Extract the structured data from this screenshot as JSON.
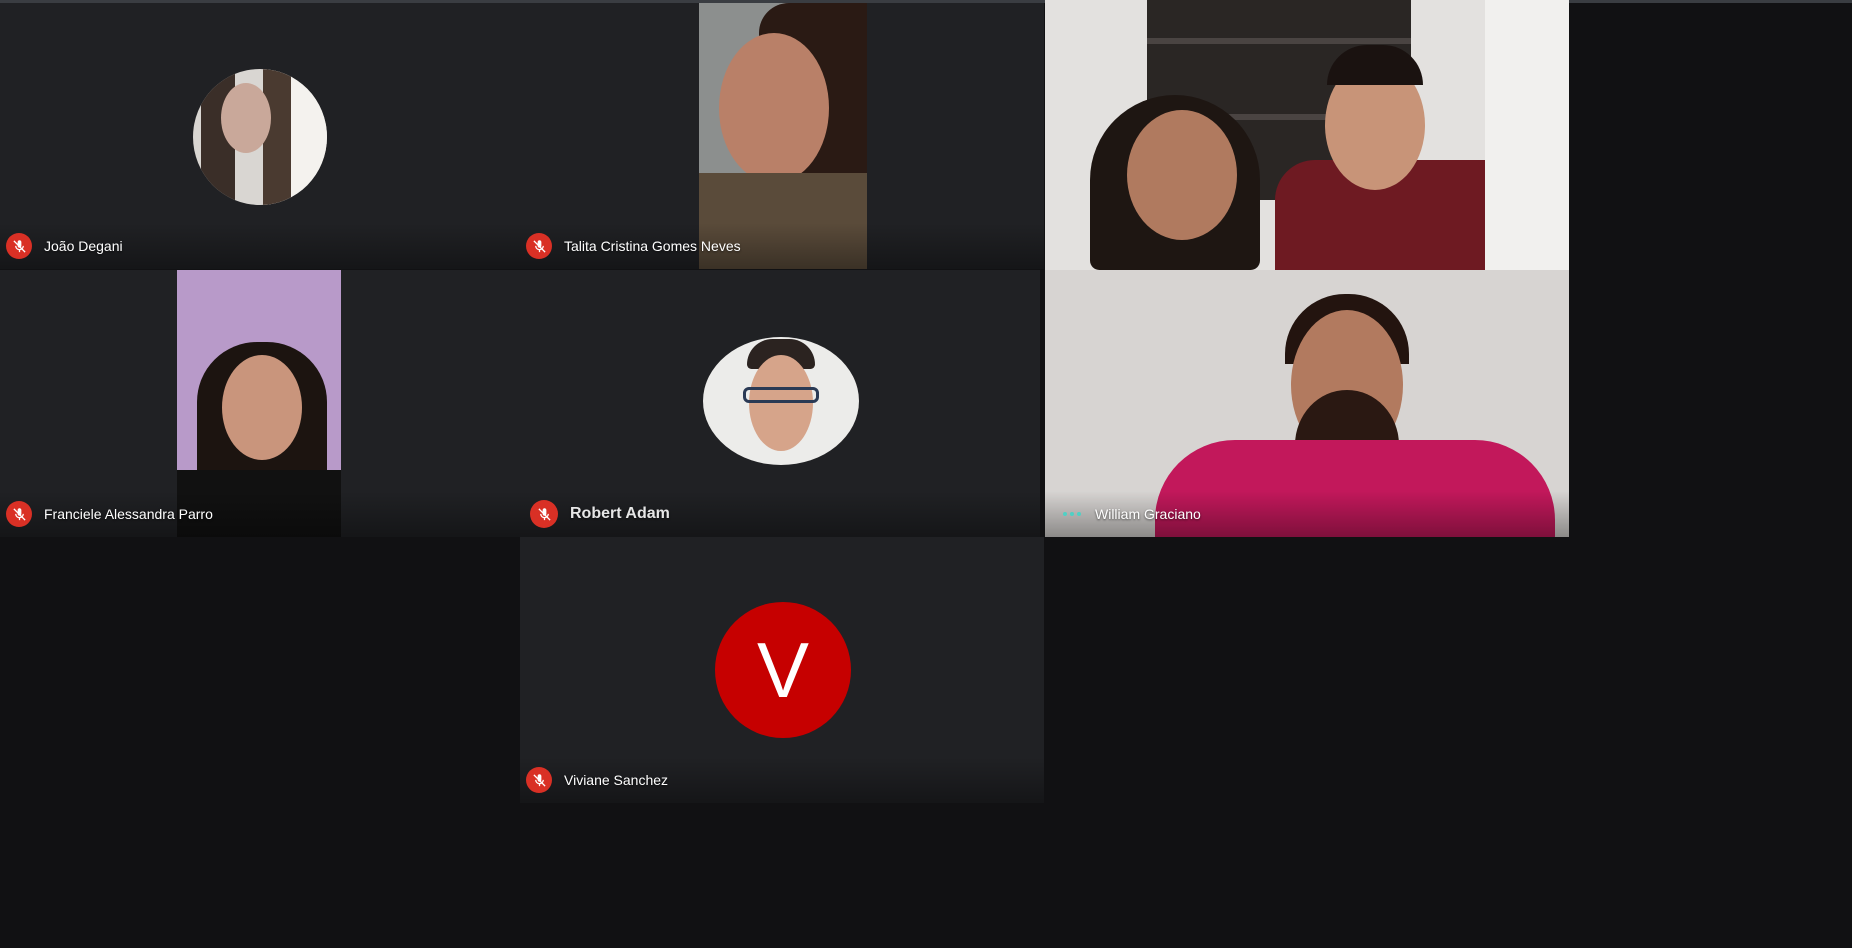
{
  "participants": [
    {
      "name": "João Degani",
      "muted": true
    },
    {
      "name": "Talita Cristina Gomes Neves",
      "muted": true
    },
    {
      "name": "",
      "muted": false
    },
    {
      "name": "Franciele Alessandra Parro",
      "muted": true
    },
    {
      "name": "Robert Adam",
      "muted": true
    },
    {
      "name": "William Graciano",
      "muted": false,
      "speaking": true
    },
    {
      "name": "Viviane Sanchez",
      "muted": true,
      "avatar_letter": "V"
    }
  ],
  "colors": {
    "tile_bg": "#202124",
    "page_bg": "#111113",
    "muted_badge": "#d93025",
    "avatar_red": "#c60000",
    "speaking_dots": "#4fd1c5"
  },
  "icons": {
    "muted": "mic-off-icon",
    "speaking": "audio-indicator-icon"
  }
}
